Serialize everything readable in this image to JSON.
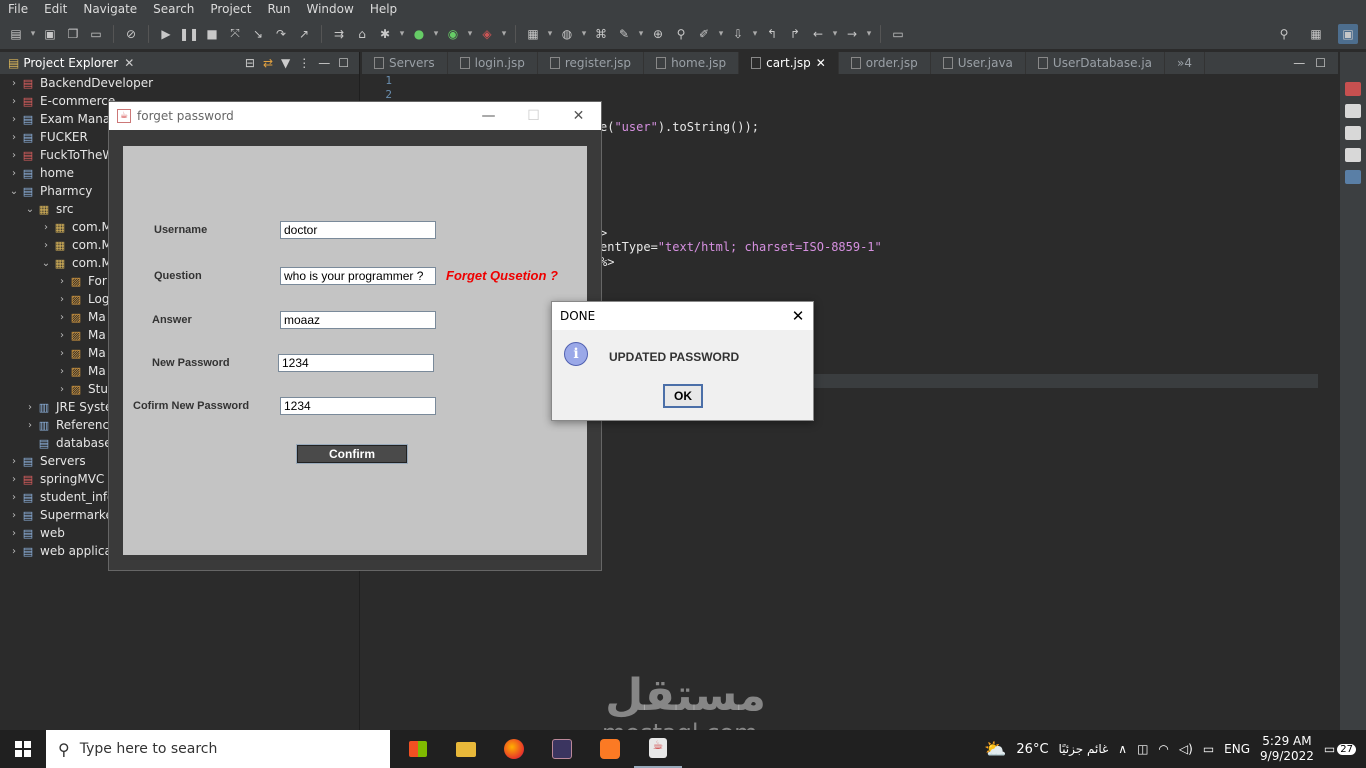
{
  "menu": [
    "File",
    "Edit",
    "Navigate",
    "Search",
    "Project",
    "Run",
    "Window",
    "Help"
  ],
  "explorer": {
    "title": "Project Explorer",
    "items": [
      {
        "label": "BackendDeveloper",
        "indent": 0,
        "arrow": "›",
        "kind": "proj-err"
      },
      {
        "label": "E-commerce",
        "indent": 0,
        "arrow": "›",
        "kind": "proj-err"
      },
      {
        "label": "Exam Manag",
        "indent": 0,
        "arrow": "›",
        "kind": "proj"
      },
      {
        "label": "FUCKER",
        "indent": 0,
        "arrow": "›",
        "kind": "proj"
      },
      {
        "label": "FuckToTheW",
        "indent": 0,
        "arrow": "›",
        "kind": "proj-err"
      },
      {
        "label": "home",
        "indent": 0,
        "arrow": "›",
        "kind": "proj"
      },
      {
        "label": "Pharmcy",
        "indent": 0,
        "arrow": "⌄",
        "kind": "proj"
      },
      {
        "label": "src",
        "indent": 1,
        "arrow": "⌄",
        "kind": "pkg"
      },
      {
        "label": "com.M",
        "indent": 2,
        "arrow": "›",
        "kind": "pkg"
      },
      {
        "label": "com.M",
        "indent": 2,
        "arrow": "›",
        "kind": "pkg"
      },
      {
        "label": "com.M",
        "indent": 2,
        "arrow": "⌄",
        "kind": "pkg"
      },
      {
        "label": "For",
        "indent": 3,
        "arrow": "›",
        "kind": "java"
      },
      {
        "label": "Log",
        "indent": 3,
        "arrow": "›",
        "kind": "java"
      },
      {
        "label": "Ma",
        "indent": 3,
        "arrow": "›",
        "kind": "java"
      },
      {
        "label": "Ma",
        "indent": 3,
        "arrow": "›",
        "kind": "java"
      },
      {
        "label": "Ma",
        "indent": 3,
        "arrow": "›",
        "kind": "java"
      },
      {
        "label": "Ma",
        "indent": 3,
        "arrow": "›",
        "kind": "java"
      },
      {
        "label": "Stu",
        "indent": 3,
        "arrow": "›",
        "kind": "java"
      },
      {
        "label": "JRE Syster",
        "indent": 1,
        "arrow": "›",
        "kind": "lib"
      },
      {
        "label": "Reference",
        "indent": 1,
        "arrow": "›",
        "kind": "lib"
      },
      {
        "label": "database.",
        "indent": 1,
        "arrow": "",
        "kind": "file"
      },
      {
        "label": "Servers",
        "indent": 0,
        "arrow": "›",
        "kind": "proj"
      },
      {
        "label": "springMVC",
        "indent": 0,
        "arrow": "›",
        "kind": "proj-err"
      },
      {
        "label": "student_info",
        "indent": 0,
        "arrow": "›",
        "kind": "proj"
      },
      {
        "label": "Supermarket",
        "indent": 0,
        "arrow": "›",
        "kind": "proj"
      },
      {
        "label": "web",
        "indent": 0,
        "arrow": "›",
        "kind": "proj"
      },
      {
        "label": "web applicat",
        "indent": 0,
        "arrow": "›",
        "kind": "proj"
      }
    ]
  },
  "tabs": [
    {
      "label": "Servers",
      "active": false
    },
    {
      "label": "login.jsp",
      "active": false
    },
    {
      "label": "register.jsp",
      "active": false
    },
    {
      "label": "home.jsp",
      "active": false
    },
    {
      "label": "cart.jsp",
      "active": true
    },
    {
      "label": "order.jsp",
      "active": false
    },
    {
      "label": "User.java",
      "active": false
    },
    {
      "label": "UserDatabase.ja",
      "active": false
    },
    {
      "label": "»4",
      "active": false
    }
  ],
  "gutter": [
    "1",
    "2"
  ],
  "code": {
    "line1_pre": "e(",
    "line1_str": "\"user\"",
    "line1_post": ").toString());",
    "line2": ">",
    "line3_pre": "entType=",
    "line3_str": "\"text/html; charset=ISO-8859-1\"",
    "line4": "%>"
  },
  "forget_window": {
    "title": "forget password",
    "username_label": "Username",
    "username_value": "doctor",
    "question_label": "Question",
    "question_value": "who is your programmer ?",
    "forget_link": "Forget Qusetion ?",
    "answer_label": "Answer",
    "answer_value": "moaaz",
    "newpass_label": "New Password",
    "newpass_value": "1234",
    "confirmpass_label": "Cofirm New Password",
    "confirmpass_value": "1234",
    "confirm_button": "Confirm"
  },
  "dialog": {
    "title": "DONE",
    "message": "UPDATED PASSWORD",
    "ok": "OK"
  },
  "taskbar": {
    "search_placeholder": "Type here to search",
    "weather": "26°C",
    "weather_text": "غائم جزئيًا",
    "lang": "ENG",
    "time": "5:29 AM",
    "date": "9/9/2022",
    "notifications": "27"
  },
  "watermark": {
    "arabic": "مستقل",
    "latin": "mostaql.com"
  }
}
